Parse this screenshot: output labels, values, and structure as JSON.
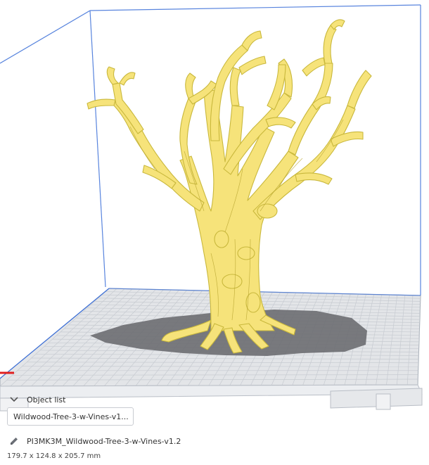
{
  "object_list": {
    "label": "Object list",
    "selected_object": "Wildwood-Tree-3-w-Vines-v1..."
  },
  "job": {
    "file_name": "PI3MK3M_Wildwood-Tree-3-w-Vines-v1.2",
    "dimensions": "179.7 x 124.8 x 205.7 mm"
  },
  "icons": {
    "collapse": "chevron-down-icon",
    "edit": "pencil-icon"
  },
  "colors": {
    "model": "#f6e37a",
    "model_outline": "#c9b83c",
    "build_volume_edge": "#3b6fd8",
    "build_plate": "#e3e5e8",
    "grid": "#c7cbd1",
    "shadow": "#6b6d71",
    "x_axis": "#e02020"
  }
}
